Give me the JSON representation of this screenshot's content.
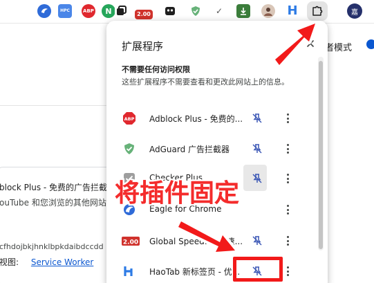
{
  "toolbar": {
    "extension_icons": [
      {
        "name": "eagle-icon",
        "label": ""
      },
      {
        "name": "hpc-icon",
        "label": "HPC"
      },
      {
        "name": "adblock-icon",
        "label": "ABP"
      },
      {
        "name": "n-icon",
        "label": "N"
      },
      {
        "name": "square-icon",
        "label": ""
      },
      {
        "name": "global-speed-icon",
        "label": "2.00"
      },
      {
        "name": "ghost-icon",
        "label": ""
      },
      {
        "name": "adguard-icon",
        "label": ""
      },
      {
        "name": "check-icon",
        "label": "✓"
      },
      {
        "name": "download-icon",
        "label": ""
      },
      {
        "name": "profile-photo-icon",
        "label": ""
      },
      {
        "name": "haotab-icon",
        "label": "H"
      }
    ],
    "avatar_label": "嘉"
  },
  "background": {
    "dev_mode_label": "者模式",
    "card_name": "block Plus - 免费的广告拦截器",
    "card_desc": "ouTube 和您浏览的其他网站",
    "card_id": "cfhdojbkjhnklbpkdaibdccdd",
    "card_view_label": "视图:",
    "card_view_link": "Service Worker"
  },
  "popup": {
    "title": "扩展程序",
    "section_title": "不需要任何访问权限",
    "section_desc": "这些扩展程序不需要查看和更改此网站上的信息。",
    "extensions": [
      {
        "name": "Adblock Plus - 免费的...",
        "icon": "adblock-icon"
      },
      {
        "name": "AdGuard 广告拦截器",
        "icon": "adguard-icon"
      },
      {
        "name": "Checker Plus",
        "icon": "check-icon"
      },
      {
        "name": "Eagle for Chrome",
        "icon": "eagle-icon"
      },
      {
        "name": "Global Speed: 视频速...",
        "icon": "global-speed-icon"
      },
      {
        "name": "HaoTab 新标签页 - 优...",
        "icon": "haotab-icon"
      }
    ]
  },
  "annotation": {
    "text": "将插件固定"
  },
  "colors": {
    "annotation_red": "#f42c2c",
    "accent_blue": "#0b57d0"
  }
}
